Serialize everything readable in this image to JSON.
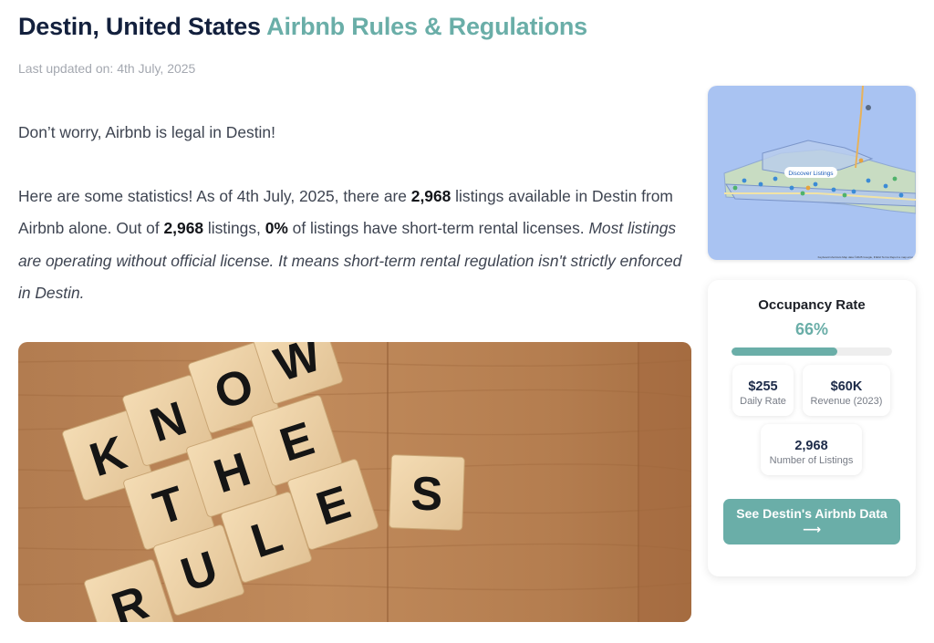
{
  "header": {
    "location": "Destin, United States",
    "accent": "Airbnb Rules & Regulations",
    "updated": "Last updated on: 4th July, 2025"
  },
  "article": {
    "intro": "Don’t worry, Airbnb is legal in Destin!",
    "stats_p1": "Here are some statistics! As of 4th July, 2025, there are ",
    "listings_count": "2,968",
    "stats_p2": " listings available in Destin from Airbnb alone. Out of ",
    "listings_count_2": "2,968",
    "stats_p3": " listings, ",
    "licensed_pct": "0%",
    "stats_p4": " of listings have short-term rental licenses. ",
    "emphasis": "Most listings are operating without official license. It means short-term rental regulation isn't strictly enforced in Destin."
  },
  "hero_image": {
    "description_icon": "know-the-rules-blocks",
    "blocks": [
      "K",
      "N",
      "O",
      "W",
      "T",
      "H",
      "E",
      "R",
      "U",
      "L",
      "E",
      "S"
    ]
  },
  "map": {
    "pin_label": "Discover Listings",
    "attribution": "Keyboard shortcuts   Map data ©2025 Google, INEGI   Terms   Report a map error"
  },
  "stats": {
    "occupancy_label": "Occupancy Rate",
    "occupancy_value": "66%",
    "occupancy_fraction": 0.66,
    "daily_rate_value": "$255",
    "daily_rate_label": "Daily Rate",
    "revenue_value": "$60K",
    "revenue_label": "Revenue (2023)",
    "listings_value": "2,968",
    "listings_label": "Number of Listings",
    "cta_line1": "See Destin's Airbnb Data",
    "cta_line2": "⟶"
  },
  "colors": {
    "accent": "#6aaea8",
    "title": "#13203d",
    "map_water": "#a9c3f2"
  }
}
